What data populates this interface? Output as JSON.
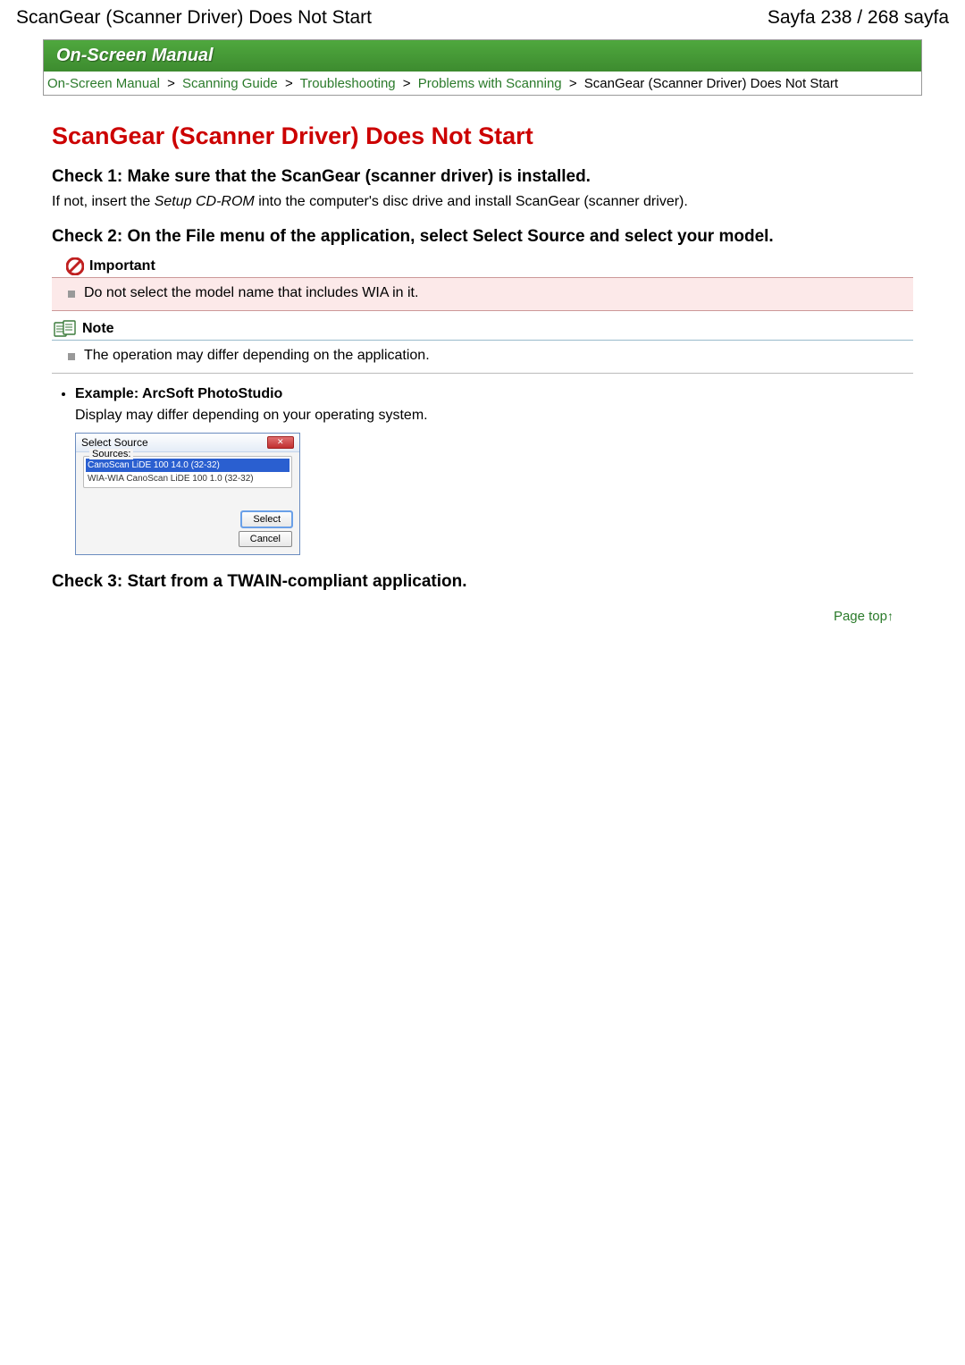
{
  "topbar": {
    "left": "ScanGear (Scanner Driver) Does Not Start",
    "right": "Sayfa 238 / 268 sayfa"
  },
  "banner": "On-Screen Manual",
  "breadcrumbs": {
    "items": [
      "On-Screen Manual",
      "Scanning Guide",
      "Troubleshooting",
      "Problems with Scanning"
    ],
    "current": "ScanGear (Scanner Driver) Does Not Start",
    "sep": ">"
  },
  "title": "ScanGear (Scanner Driver) Does Not Start",
  "check1": {
    "heading": "Check 1: Make sure that the ScanGear (scanner driver) is installed.",
    "text_pre": "If not, insert the ",
    "text_italic": "Setup CD-ROM",
    "text_post": " into the computer's disc drive and install ScanGear (scanner driver)."
  },
  "check2": {
    "heading": "Check 2: On the File menu of the application, select Select Source and select your model."
  },
  "important": {
    "label": "Important",
    "text": "Do not select the model name that includes WIA in it."
  },
  "note": {
    "label": "Note",
    "text": "The operation may differ depending on the application."
  },
  "example": {
    "bullet": "Example: ArcSoft PhotoStudio",
    "text": "Display may differ depending on your operating system."
  },
  "dialog": {
    "title": "Select Source",
    "legend": "Sources:",
    "items": [
      {
        "label": "CanoScan LiDE 100 14.0 (32-32)",
        "selected": true
      },
      {
        "label": "WIA-WIA CanoScan LiDE 100 1.0 (32-32)",
        "selected": false
      }
    ],
    "buttons": {
      "select": "Select",
      "cancel": "Cancel"
    }
  },
  "check3": {
    "heading": "Check 3: Start from a TWAIN-compliant application."
  },
  "pagetop": "Page top"
}
